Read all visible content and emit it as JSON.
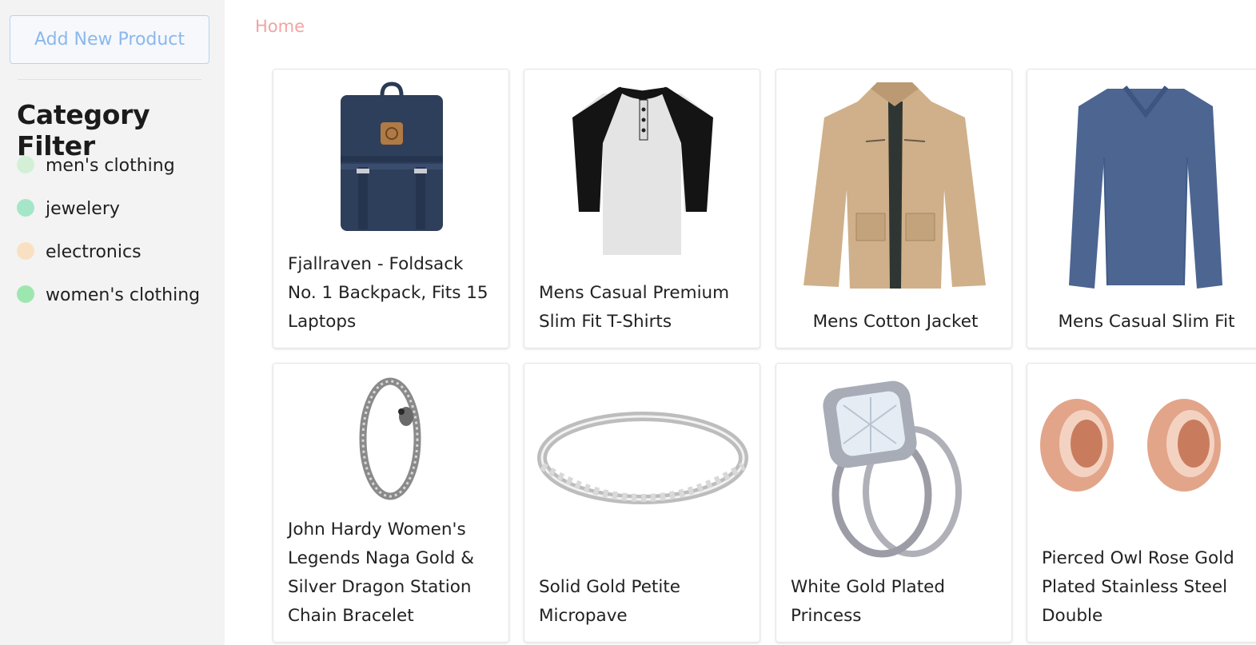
{
  "sidebar": {
    "add_button_label": "Add New Product",
    "filter_title": "Category Filter",
    "categories": [
      {
        "label": "men's clothing",
        "color": "#d3f0d6"
      },
      {
        "label": "jewelery",
        "color": "#a5e6c8"
      },
      {
        "label": "electronics",
        "color": "#fae0c2"
      },
      {
        "label": "women's clothing",
        "color": "#9ee6b0"
      }
    ]
  },
  "breadcrumb": {
    "home_label": "Home"
  },
  "products": [
    {
      "title": "Fjallraven - Foldsack No. 1 Backpack, Fits 15 Laptops",
      "image": "backpack-image"
    },
    {
      "title": "Mens Casual Premium Slim Fit T-Shirts",
      "image": "raglan-tshirt-image"
    },
    {
      "title": "Mens Cotton Jacket",
      "image": "cotton-jacket-image"
    },
    {
      "title": "Mens Casual Slim Fit",
      "image": "longsleeve-shirt-image"
    },
    {
      "title": "John Hardy Women's Legends Naga Gold & Silver Dragon Station Chain Bracelet",
      "image": "dragon-bracelet-image"
    },
    {
      "title": "Solid Gold Petite Micropave",
      "image": "micropave-ring-image"
    },
    {
      "title": "White Gold Plated Princess",
      "image": "princess-ring-image"
    },
    {
      "title": "Pierced Owl Rose Gold Plated Stainless Steel Double",
      "image": "rose-gold-plugs-image"
    }
  ],
  "colors": {
    "accent_blue": "#8ab8ee",
    "breadcrumb_pink": "#f3a3a3",
    "sidebar_bg": "#f3f3f3"
  }
}
